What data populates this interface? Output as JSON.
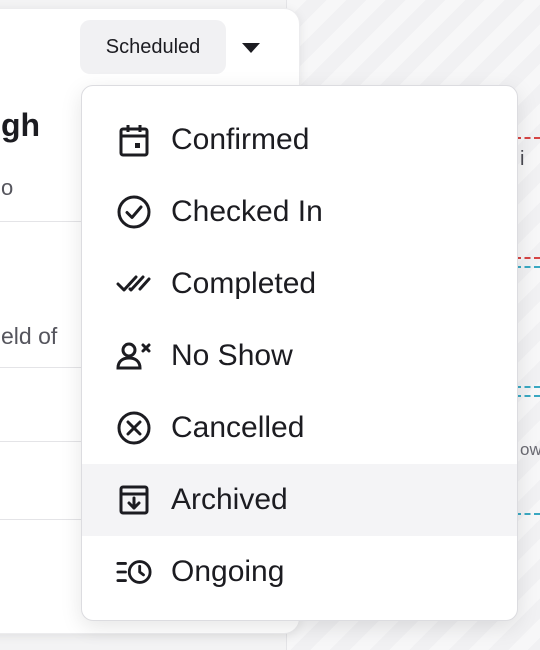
{
  "panel": {
    "title_partial": "gh",
    "subtitle_partial": "o",
    "description_partial": "eld of"
  },
  "status_button": {
    "label": "Scheduled",
    "caret_icon": "caret-down-icon"
  },
  "background_calendar": {
    "snippet_top": "i",
    "snippet_bottom": "ow"
  },
  "status_menu": {
    "items": [
      {
        "label": "Confirmed",
        "icon": "calendar-event-icon"
      },
      {
        "label": "Checked In",
        "icon": "check-circle-icon"
      },
      {
        "label": "Completed",
        "icon": "double-check-icon"
      },
      {
        "label": "No Show",
        "icon": "user-x-icon"
      },
      {
        "label": "Cancelled",
        "icon": "x-circle-icon"
      },
      {
        "label": "Archived",
        "icon": "archive-icon",
        "highlighted": true
      },
      {
        "label": "Ongoing",
        "icon": "list-clock-icon"
      }
    ]
  },
  "colors": {
    "menu_hover": "#f4f4f6",
    "button_bg": "#f1f1f3",
    "text": "#1c1c21",
    "calendar_red_line": "#d64545",
    "calendar_blue_line": "#3aa8c2"
  }
}
